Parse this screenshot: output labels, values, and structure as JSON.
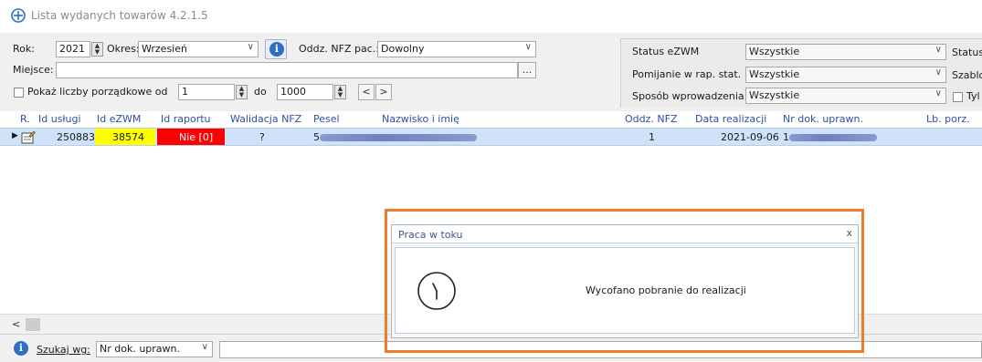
{
  "window": {
    "title": "Lista wydanych towarów 4.2.1.5",
    "icon": "globe-plus-icon"
  },
  "filters": {
    "rok_label": "Rok:",
    "rok_value": "2021",
    "okres_label": "Okres:",
    "okres_value": "Wrzesień",
    "oddz_label": "Oddz. NFZ pac.:",
    "oddz_value": "Dowolny",
    "miejsce_label": "Miejsce:",
    "miejsce_value": "",
    "miejsce_browse": "...",
    "pokaz_label": "Pokaż liczby porządkowe od",
    "pokaz_from": "1",
    "do_label": "do",
    "pokaz_to": "1000",
    "prev": "<",
    "next": ">"
  },
  "right_filters": {
    "status_label": "Status eZWM",
    "status_value": "Wszystkie",
    "status2_label": "Status",
    "pomijanie_label": "Pomijanie w rap. stat.",
    "pomijanie_value": "Wszystkie",
    "szablo_label": "Szablo",
    "sposob_label": "Sposób wprowadzenia",
    "sposob_value": "Wszystkie",
    "tyl_label": "Tyl"
  },
  "grid": {
    "columns": [
      "R.",
      "Id usługi",
      "Id eZWM",
      "Id raportu",
      "Walidacja NFZ",
      "Pesel",
      "Nazwisko i imię",
      "Oddz. NFZ",
      "Data realizacji",
      "Nr dok. uprawn.",
      "Lb. porz."
    ],
    "rows": [
      {
        "id_uslugi": "250883",
        "id_ezwm": "38574",
        "id_raportu": "Nie [0]",
        "walidacja": "?",
        "pesel": "5",
        "oddz": "1",
        "data": "2021-09-06",
        "nr_dok": "1"
      }
    ]
  },
  "scroll": {
    "left_arrow": "<"
  },
  "search": {
    "label": "Szukaj wg:",
    "value": "Nr dok. uprawn.",
    "query": ""
  },
  "dialog": {
    "title": "Praca w toku",
    "close": "x",
    "message": "Wycofano pobranie do realizacji"
  },
  "colors": {
    "accent_orange": "#ef7c2a",
    "selected_row": "#cfe2f7",
    "ezwm_yellow": "#ffff00",
    "raport_red": "#ff0000",
    "header_text": "#2d4fa0"
  }
}
